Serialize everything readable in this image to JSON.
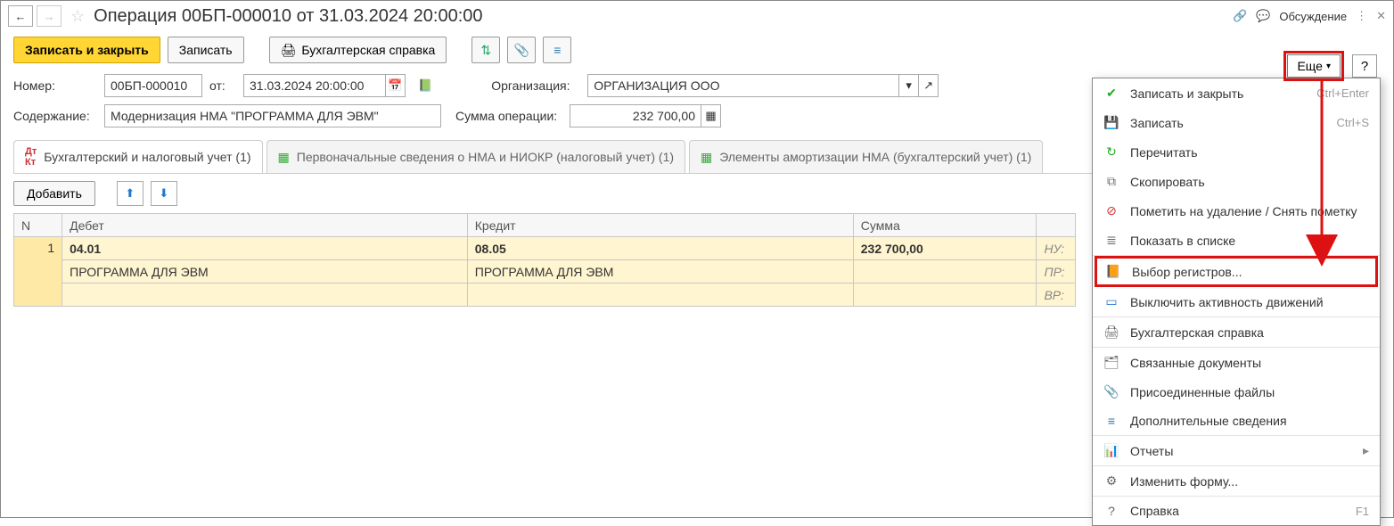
{
  "header": {
    "title": "Операция 00БП-000010 от 31.03.2024 20:00:00",
    "discuss": "Обсуждение"
  },
  "toolbar": {
    "write_close": "Записать и закрыть",
    "write": "Записать",
    "print_ref": "Бухгалтерская справка",
    "more": "Еще",
    "help": "?"
  },
  "form": {
    "number_lbl": "Номер:",
    "number": "00БП-000010",
    "from_lbl": "от:",
    "date": "31.03.2024 20:00:00",
    "org_lbl": "Организация:",
    "org": "ОРГАНИЗАЦИЯ ООО",
    "content_lbl": "Содержание:",
    "content": "Модернизация НМА \"ПРОГРАММА ДЛЯ ЭВМ\"",
    "sum_lbl": "Сумма операции:",
    "sum": "232 700,00"
  },
  "tabs": [
    "Бухгалтерский и налоговый учет (1)",
    "Первоначальные сведения о НМА и НИОКР (налоговый учет) (1)",
    "Элементы амортизации НМА (бухгалтерский учет) (1)"
  ],
  "subtoolbar": {
    "add": "Добавить"
  },
  "grid": {
    "cols": {
      "n": "N",
      "debit": "Дебет",
      "credit": "Кредит",
      "sum": "Сумма"
    },
    "row": {
      "n": "1",
      "debit_acc": "04.01",
      "credit_acc": "08.05",
      "sum": "232 700,00",
      "nu": "НУ:",
      "debit_obj": "ПРОГРАММА ДЛЯ ЭВМ",
      "credit_obj": "ПРОГРАММА ДЛЯ ЭВМ",
      "pr": "ПР:",
      "vr": "ВР:"
    }
  },
  "menu": {
    "items": [
      {
        "icon": "✔",
        "label": "Записать и закрыть",
        "shortcut": "Ctrl+Enter"
      },
      {
        "icon": "💾",
        "label": "Записать",
        "shortcut": "Ctrl+S"
      },
      {
        "icon": "↻",
        "label": "Перечитать",
        "shortcut": ""
      },
      {
        "icon": "⧉",
        "label": "Скопировать",
        "shortcut": ""
      },
      {
        "icon": "⊘",
        "label": "Пометить на удаление / Снять пометку",
        "shortcut": ""
      },
      {
        "icon": "≣",
        "label": "Показать в списке",
        "shortcut": ""
      },
      {
        "icon": "📙",
        "label": "Выбор регистров...",
        "shortcut": ""
      },
      {
        "icon": "▭",
        "label": "Выключить активность движений",
        "shortcut": ""
      },
      {
        "icon": "🖨",
        "label": "Бухгалтерская справка",
        "shortcut": ""
      },
      {
        "icon": "🗂",
        "label": "Связанные документы",
        "shortcut": ""
      },
      {
        "icon": "📎",
        "label": "Присоединенные файлы",
        "shortcut": ""
      },
      {
        "icon": "≡",
        "label": "Дополнительные сведения",
        "shortcut": ""
      },
      {
        "icon": "📊",
        "label": "Отчеты",
        "shortcut": "",
        "arrow": true
      },
      {
        "icon": "⚙",
        "label": "Изменить форму...",
        "shortcut": ""
      },
      {
        "icon": "?",
        "label": "Справка",
        "shortcut": "F1"
      }
    ]
  }
}
